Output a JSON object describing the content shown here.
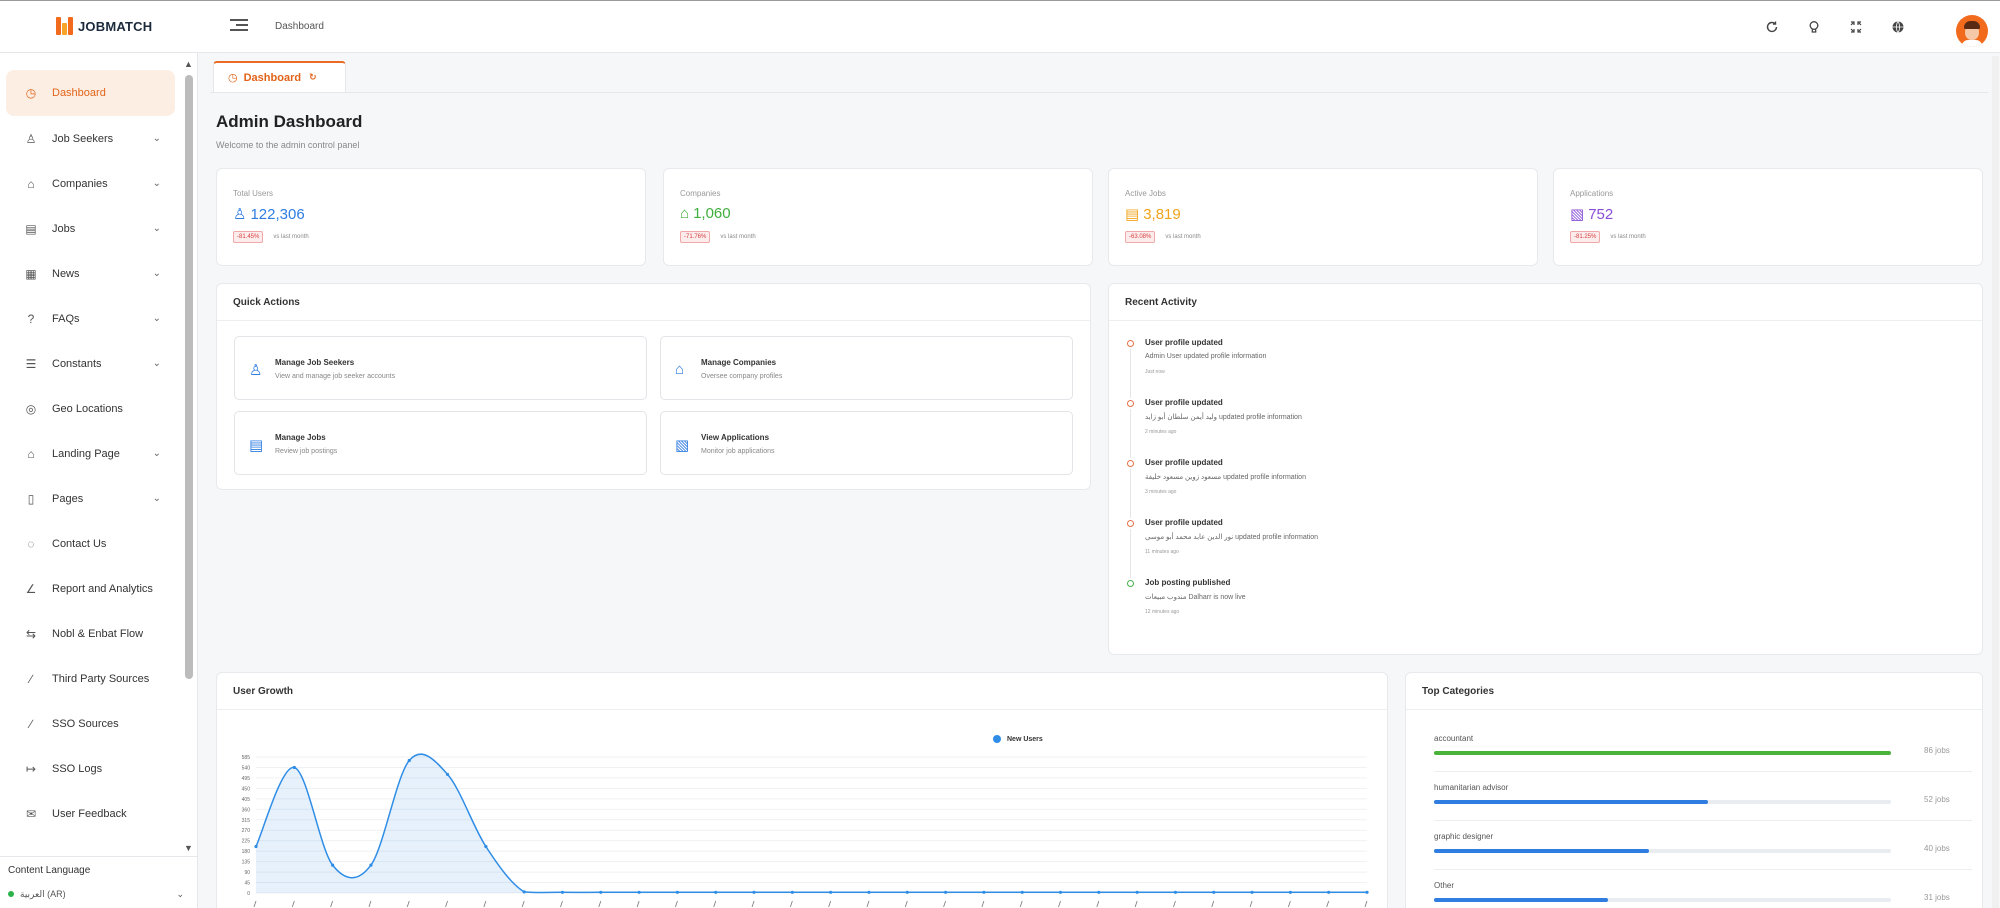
{
  "app": {
    "name": "JOBMATCH"
  },
  "header": {
    "breadcrumb": "Dashboard"
  },
  "sidebar": {
    "items": [
      {
        "label": "Dashboard",
        "icon": "dashboard-icon",
        "active": true
      },
      {
        "label": "Job Seekers",
        "icon": "user-icon",
        "expandable": true
      },
      {
        "label": "Companies",
        "icon": "building-icon",
        "expandable": true
      },
      {
        "label": "Jobs",
        "icon": "document-icon",
        "expandable": true
      },
      {
        "label": "News",
        "icon": "newspaper-icon",
        "expandable": true
      },
      {
        "label": "FAQs",
        "icon": "help-icon",
        "expandable": true
      },
      {
        "label": "Constants",
        "icon": "list-icon",
        "expandable": true
      },
      {
        "label": "Geo Locations",
        "icon": "location-icon"
      },
      {
        "label": "Landing Page",
        "icon": "home-icon",
        "expandable": true
      },
      {
        "label": "Pages",
        "icon": "page-icon",
        "expandable": true
      },
      {
        "label": "Contact Us",
        "icon": "contact-icon"
      },
      {
        "label": "Report and Analytics",
        "icon": "chart-icon"
      },
      {
        "label": "Nobl & Enbat Flow",
        "icon": "swap-icon"
      },
      {
        "label": "Third Party Sources",
        "icon": "link-icon"
      },
      {
        "label": "SSO Sources",
        "icon": "link-icon"
      },
      {
        "label": "SSO Logs",
        "icon": "login-icon"
      },
      {
        "label": "User Feedback",
        "icon": "feedback-icon"
      }
    ],
    "content_language": {
      "label": "Content Language",
      "value": "العربية (AR)"
    }
  },
  "tab": {
    "label": "Dashboard"
  },
  "page": {
    "title": "Admin Dashboard",
    "subtitle": "Welcome to the admin control panel"
  },
  "stats": [
    {
      "label": "Total Users",
      "value": "122,306",
      "change": "-81.45%",
      "suffix": "vs last month",
      "color": "#2f7de1",
      "icon": "user-icon"
    },
    {
      "label": "Companies",
      "value": "1,060",
      "change": "-71.76%",
      "suffix": "vs last month",
      "color": "#3fae3b",
      "icon": "building-icon"
    },
    {
      "label": "Active Jobs",
      "value": "3,819",
      "change": "-63.08%",
      "suffix": "vs last month",
      "color": "#f0a31b",
      "icon": "document-icon"
    },
    {
      "label": "Applications",
      "value": "752",
      "change": "-81.25%",
      "suffix": "vs last month",
      "color": "#8b4fd6",
      "icon": "clipboard-icon"
    }
  ],
  "quick_actions": {
    "title": "Quick Actions",
    "items": [
      {
        "title": "Manage Job Seekers",
        "desc": "View and manage job seeker accounts",
        "icon": "user-icon"
      },
      {
        "title": "Manage Companies",
        "desc": "Oversee company profiles",
        "icon": "building-icon"
      },
      {
        "title": "Manage Jobs",
        "desc": "Review job postings",
        "icon": "document-icon"
      },
      {
        "title": "View Applications",
        "desc": "Monitor job applications",
        "icon": "clipboard-icon"
      }
    ]
  },
  "recent_activity": {
    "title": "Recent Activity",
    "items": [
      {
        "title": "User profile updated",
        "desc": "Admin User updated profile information",
        "time": "Just now",
        "status": "orange"
      },
      {
        "title": "User profile updated",
        "desc": "وليد أيمن سلطان أبو زايد updated profile information",
        "time": "2 minutes ago",
        "status": "orange"
      },
      {
        "title": "User profile updated",
        "desc": "مسعود زوين مسعود خليفة updated profile information",
        "time": "3 minutes ago",
        "status": "orange"
      },
      {
        "title": "User profile updated",
        "desc": "نور الدين عابد محمد أبو موسى updated profile information",
        "time": "11 minutes ago",
        "status": "orange"
      },
      {
        "title": "Job posting published",
        "desc": "مندوب مبيعات Dalharr is now live",
        "time": "12 minutes ago",
        "status": "green"
      }
    ]
  },
  "user_growth": {
    "title": "User Growth",
    "chart_data": {
      "type": "area",
      "series": [
        {
          "name": "New Users",
          "color": "#2f8de6",
          "values": [
            200,
            540,
            120,
            120,
            570,
            510,
            200,
            5,
            3,
            3,
            3,
            3,
            3,
            3,
            3,
            3,
            3,
            3,
            3,
            3,
            3,
            3,
            3,
            3,
            3,
            3,
            3,
            3,
            3,
            3
          ]
        }
      ],
      "y_ticks": [
        "585",
        "540",
        "495",
        "450",
        "405",
        "360",
        "315",
        "270",
        "225",
        "180",
        "135",
        "90",
        "45",
        "0"
      ],
      "ylim": [
        0,
        585
      ]
    }
  },
  "top_categories": {
    "title": "Top Categories",
    "items": [
      {
        "name": "accountant",
        "count": "86 jobs",
        "fraction": 1.0,
        "color": "#4ab33a"
      },
      {
        "name": "humanitarian advisor",
        "count": "52 jobs",
        "fraction": 0.6,
        "color": "#2f7de1"
      },
      {
        "name": "graphic designer",
        "count": "40 jobs",
        "fraction": 0.47,
        "color": "#2f7de1"
      },
      {
        "name": "Other",
        "count": "31 jobs",
        "fraction": 0.38,
        "color": "#2f7de1"
      }
    ]
  }
}
